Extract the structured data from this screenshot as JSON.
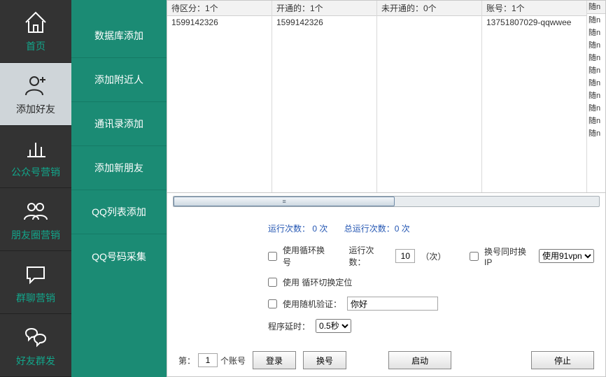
{
  "nav": [
    {
      "label": "首页",
      "name": "nav-home"
    },
    {
      "label": "添加好友",
      "name": "nav-add-friend",
      "selected": true
    },
    {
      "label": "公众号营销",
      "name": "nav-official"
    },
    {
      "label": "朋友圈营销",
      "name": "nav-moments"
    },
    {
      "label": "群聊营销",
      "name": "nav-groupchat"
    },
    {
      "label": "好友群发",
      "name": "nav-broadcast"
    }
  ],
  "subnav": [
    "数据库添加",
    "添加附近人",
    "通讯录添加",
    "添加新朋友",
    "QQ列表添加",
    "QQ号码采集"
  ],
  "lists": {
    "pending": {
      "header": "待区分：1个",
      "rows": [
        "1599142326"
      ]
    },
    "opened": {
      "header": "开通的：1个",
      "rows": [
        "1599142326"
      ]
    },
    "unopened": {
      "header": "未开通的：0个",
      "rows": []
    },
    "accounts": {
      "header": "账号：1个",
      "rows": [
        "13751807029-qqwwee"
      ]
    },
    "random": {
      "header": "随n",
      "rows": [
        "随n",
        "随n",
        "随n",
        "随n",
        "随n",
        "随n",
        "随n",
        "随n",
        "随n",
        "随n"
      ]
    }
  },
  "stats": {
    "run": "运行次数： 0 次",
    "total": "总运行次数：0 次"
  },
  "form": {
    "loop_label": "使用循环换号",
    "run_times_label": "运行次数：",
    "run_times_value": "10",
    "times_suffix": "（次）",
    "swap_ip_label": "换号同时换IP",
    "ip_select": "使用91vpn",
    "relocate_label": "使用 循环切换定位",
    "random_captcha_label": "使用随机验证：",
    "random_captcha_value": "你好",
    "delay_label": "程序延时：",
    "delay_value": "0.5秒"
  },
  "bottom": {
    "prefix": "第：",
    "index": "1",
    "suffix": "个账号",
    "login": "登录",
    "swap": "换号",
    "start": "启动",
    "stop": "停止"
  }
}
